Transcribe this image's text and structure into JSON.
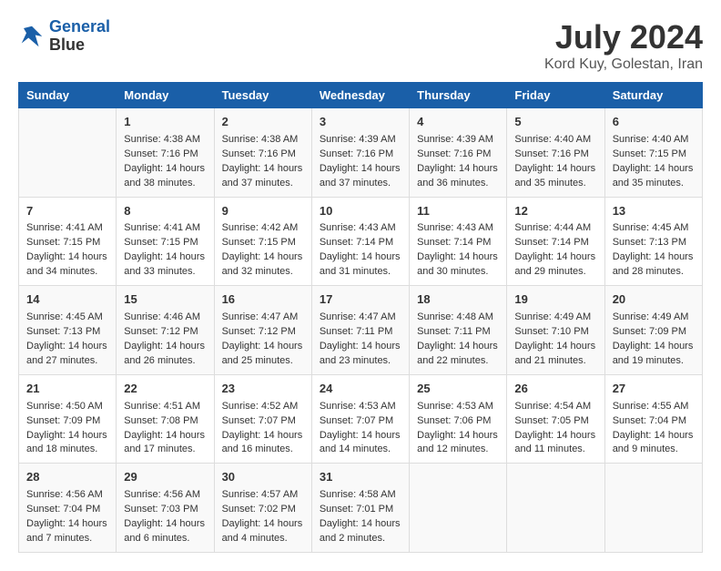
{
  "header": {
    "logo_line1": "General",
    "logo_line2": "Blue",
    "month_year": "July 2024",
    "location": "Kord Kuy, Golestan, Iran"
  },
  "days_of_week": [
    "Sunday",
    "Monday",
    "Tuesday",
    "Wednesday",
    "Thursday",
    "Friday",
    "Saturday"
  ],
  "weeks": [
    [
      {
        "day": "",
        "sunrise": "",
        "sunset": "",
        "daylight": ""
      },
      {
        "day": "1",
        "sunrise": "Sunrise: 4:38 AM",
        "sunset": "Sunset: 7:16 PM",
        "daylight": "Daylight: 14 hours and 38 minutes."
      },
      {
        "day": "2",
        "sunrise": "Sunrise: 4:38 AM",
        "sunset": "Sunset: 7:16 PM",
        "daylight": "Daylight: 14 hours and 37 minutes."
      },
      {
        "day": "3",
        "sunrise": "Sunrise: 4:39 AM",
        "sunset": "Sunset: 7:16 PM",
        "daylight": "Daylight: 14 hours and 37 minutes."
      },
      {
        "day": "4",
        "sunrise": "Sunrise: 4:39 AM",
        "sunset": "Sunset: 7:16 PM",
        "daylight": "Daylight: 14 hours and 36 minutes."
      },
      {
        "day": "5",
        "sunrise": "Sunrise: 4:40 AM",
        "sunset": "Sunset: 7:16 PM",
        "daylight": "Daylight: 14 hours and 35 minutes."
      },
      {
        "day": "6",
        "sunrise": "Sunrise: 4:40 AM",
        "sunset": "Sunset: 7:15 PM",
        "daylight": "Daylight: 14 hours and 35 minutes."
      }
    ],
    [
      {
        "day": "7",
        "sunrise": "Sunrise: 4:41 AM",
        "sunset": "Sunset: 7:15 PM",
        "daylight": "Daylight: 14 hours and 34 minutes."
      },
      {
        "day": "8",
        "sunrise": "Sunrise: 4:41 AM",
        "sunset": "Sunset: 7:15 PM",
        "daylight": "Daylight: 14 hours and 33 minutes."
      },
      {
        "day": "9",
        "sunrise": "Sunrise: 4:42 AM",
        "sunset": "Sunset: 7:15 PM",
        "daylight": "Daylight: 14 hours and 32 minutes."
      },
      {
        "day": "10",
        "sunrise": "Sunrise: 4:43 AM",
        "sunset": "Sunset: 7:14 PM",
        "daylight": "Daylight: 14 hours and 31 minutes."
      },
      {
        "day": "11",
        "sunrise": "Sunrise: 4:43 AM",
        "sunset": "Sunset: 7:14 PM",
        "daylight": "Daylight: 14 hours and 30 minutes."
      },
      {
        "day": "12",
        "sunrise": "Sunrise: 4:44 AM",
        "sunset": "Sunset: 7:14 PM",
        "daylight": "Daylight: 14 hours and 29 minutes."
      },
      {
        "day": "13",
        "sunrise": "Sunrise: 4:45 AM",
        "sunset": "Sunset: 7:13 PM",
        "daylight": "Daylight: 14 hours and 28 minutes."
      }
    ],
    [
      {
        "day": "14",
        "sunrise": "Sunrise: 4:45 AM",
        "sunset": "Sunset: 7:13 PM",
        "daylight": "Daylight: 14 hours and 27 minutes."
      },
      {
        "day": "15",
        "sunrise": "Sunrise: 4:46 AM",
        "sunset": "Sunset: 7:12 PM",
        "daylight": "Daylight: 14 hours and 26 minutes."
      },
      {
        "day": "16",
        "sunrise": "Sunrise: 4:47 AM",
        "sunset": "Sunset: 7:12 PM",
        "daylight": "Daylight: 14 hours and 25 minutes."
      },
      {
        "day": "17",
        "sunrise": "Sunrise: 4:47 AM",
        "sunset": "Sunset: 7:11 PM",
        "daylight": "Daylight: 14 hours and 23 minutes."
      },
      {
        "day": "18",
        "sunrise": "Sunrise: 4:48 AM",
        "sunset": "Sunset: 7:11 PM",
        "daylight": "Daylight: 14 hours and 22 minutes."
      },
      {
        "day": "19",
        "sunrise": "Sunrise: 4:49 AM",
        "sunset": "Sunset: 7:10 PM",
        "daylight": "Daylight: 14 hours and 21 minutes."
      },
      {
        "day": "20",
        "sunrise": "Sunrise: 4:49 AM",
        "sunset": "Sunset: 7:09 PM",
        "daylight": "Daylight: 14 hours and 19 minutes."
      }
    ],
    [
      {
        "day": "21",
        "sunrise": "Sunrise: 4:50 AM",
        "sunset": "Sunset: 7:09 PM",
        "daylight": "Daylight: 14 hours and 18 minutes."
      },
      {
        "day": "22",
        "sunrise": "Sunrise: 4:51 AM",
        "sunset": "Sunset: 7:08 PM",
        "daylight": "Daylight: 14 hours and 17 minutes."
      },
      {
        "day": "23",
        "sunrise": "Sunrise: 4:52 AM",
        "sunset": "Sunset: 7:07 PM",
        "daylight": "Daylight: 14 hours and 16 minutes."
      },
      {
        "day": "24",
        "sunrise": "Sunrise: 4:53 AM",
        "sunset": "Sunset: 7:07 PM",
        "daylight": "Daylight: 14 hours and 14 minutes."
      },
      {
        "day": "25",
        "sunrise": "Sunrise: 4:53 AM",
        "sunset": "Sunset: 7:06 PM",
        "daylight": "Daylight: 14 hours and 12 minutes."
      },
      {
        "day": "26",
        "sunrise": "Sunrise: 4:54 AM",
        "sunset": "Sunset: 7:05 PM",
        "daylight": "Daylight: 14 hours and 11 minutes."
      },
      {
        "day": "27",
        "sunrise": "Sunrise: 4:55 AM",
        "sunset": "Sunset: 7:04 PM",
        "daylight": "Daylight: 14 hours and 9 minutes."
      }
    ],
    [
      {
        "day": "28",
        "sunrise": "Sunrise: 4:56 AM",
        "sunset": "Sunset: 7:04 PM",
        "daylight": "Daylight: 14 hours and 7 minutes."
      },
      {
        "day": "29",
        "sunrise": "Sunrise: 4:56 AM",
        "sunset": "Sunset: 7:03 PM",
        "daylight": "Daylight: 14 hours and 6 minutes."
      },
      {
        "day": "30",
        "sunrise": "Sunrise: 4:57 AM",
        "sunset": "Sunset: 7:02 PM",
        "daylight": "Daylight: 14 hours and 4 minutes."
      },
      {
        "day": "31",
        "sunrise": "Sunrise: 4:58 AM",
        "sunset": "Sunset: 7:01 PM",
        "daylight": "Daylight: 14 hours and 2 minutes."
      },
      {
        "day": "",
        "sunrise": "",
        "sunset": "",
        "daylight": ""
      },
      {
        "day": "",
        "sunrise": "",
        "sunset": "",
        "daylight": ""
      },
      {
        "day": "",
        "sunrise": "",
        "sunset": "",
        "daylight": ""
      }
    ]
  ]
}
